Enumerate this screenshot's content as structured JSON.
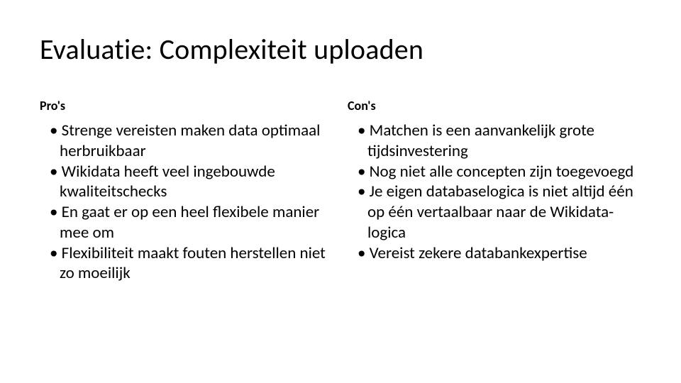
{
  "slide": {
    "title": "Evaluatie: Complexiteit uploaden",
    "left": {
      "heading": "Pro's",
      "items": [
        "Strenge vereisten maken data optimaal herbruikbaar",
        "Wikidata heeft veel ingebouwde kwaliteitschecks",
        "En gaat er op een heel flexibele manier mee om",
        "Flexibiliteit maakt fouten herstellen niet zo moeilijk"
      ]
    },
    "right": {
      "heading": "Con's",
      "items": [
        "Matchen is een aanvankelijk grote tijdsinvestering",
        "Nog niet alle concepten zijn toegevoegd",
        "Je eigen databaselogica is niet altijd één op één vertaalbaar naar de Wikidata-logica",
        "Vereist zekere databankexpertise"
      ]
    }
  }
}
